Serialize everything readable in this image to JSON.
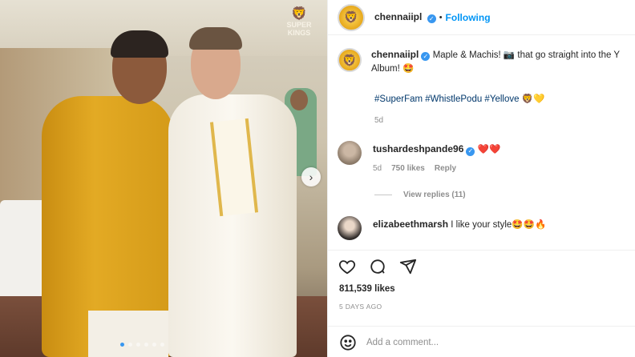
{
  "post": {
    "account": "chennaiipl",
    "follow_status": "Following",
    "separator": "•",
    "verified_glyph": "✓",
    "watermark": {
      "line1": "SUPER",
      "line2": "KINGS"
    },
    "caption": {
      "text_line1": "Maple & Machis! 📷 that go straight into the Y",
      "text_line2": "Album! 🤩",
      "hashtags": "#SuperFam #WhistlePodu #Yellove 🦁💛",
      "time": "5d"
    },
    "comments": [
      {
        "username": "tushardeshpande96",
        "text": "❤️❤️",
        "time": "5d",
        "likes": "750 likes",
        "reply_label": "Reply"
      },
      {
        "username": "elizabeethmarsh",
        "text": "I like your style🤩🤩🔥"
      }
    ],
    "view_replies": "View replies (11)",
    "likes": "811,539 likes",
    "posted_ago": "5 DAYS AGO",
    "comment_placeholder": "Add a comment...",
    "carousel": {
      "count": 6,
      "active_index": 0
    },
    "colors": {
      "accent": "#0095f6",
      "verified": "#3897f0",
      "muted": "#8e8e8e"
    },
    "icons": [
      "heart-icon",
      "comment-icon",
      "share-icon",
      "emoji-icon",
      "chevron-right-icon",
      "lion-icon"
    ]
  }
}
